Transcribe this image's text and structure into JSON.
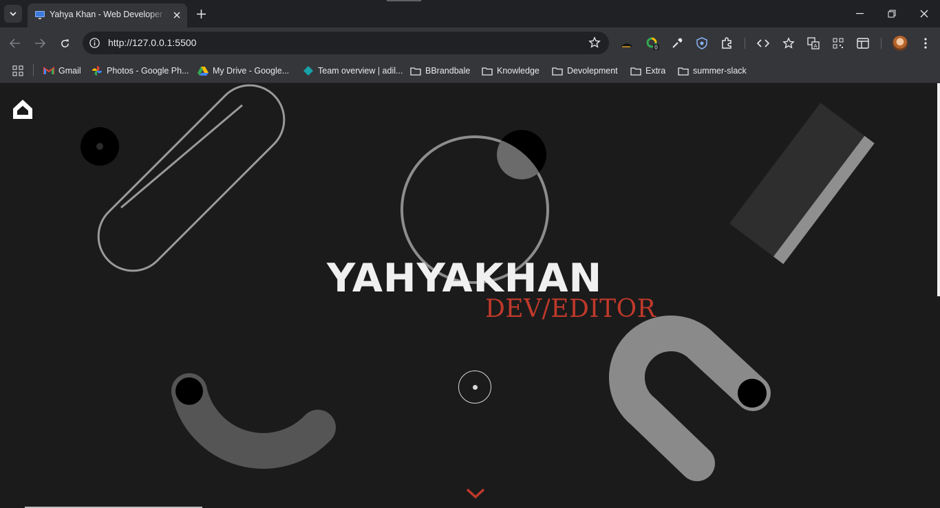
{
  "browser": {
    "tab_title": "Yahya Khan - Web Developer Portfolio",
    "url": "http://127.0.0.1:5500",
    "extension_badge": "0"
  },
  "bookmarks": [
    {
      "label": "Gmail",
      "icon": "gmail-icon"
    },
    {
      "label": "Photos - Google Ph...",
      "icon": "google-photos-icon"
    },
    {
      "label": "My Drive - Google...",
      "icon": "google-drive-icon"
    },
    {
      "label": "Team overview | adil...",
      "icon": "diamond-icon"
    },
    {
      "label": "BBrandbale",
      "icon": "folder-icon"
    },
    {
      "label": "Knowledge",
      "icon": "folder-icon"
    },
    {
      "label": "Devolepment",
      "icon": "folder-icon"
    },
    {
      "label": "Extra",
      "icon": "folder-icon"
    },
    {
      "label": "summer-slack",
      "icon": "folder-icon"
    }
  ],
  "hero": {
    "name": "YAHYAKHAN",
    "role": "DEV/EDITOR"
  },
  "colors": {
    "background": "#1b1b1b",
    "accent": "#c0392b",
    "shape_gray": "#8a8a8a",
    "chrome_dark": "#202124",
    "chrome_toolbar": "#35363a"
  }
}
